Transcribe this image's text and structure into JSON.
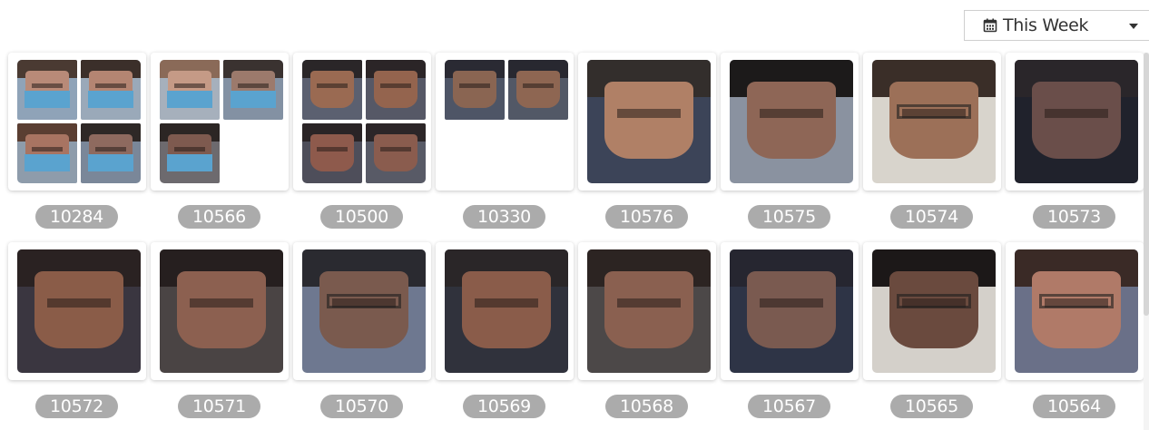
{
  "filter": {
    "range_label": "This Week",
    "icon": "calendar-icon"
  },
  "items": [
    {
      "id": "10284",
      "kind": "group",
      "faces": [
        {
          "bg": "#8fa3b8",
          "hair": "#4a3a32",
          "skin": "#b88a78",
          "mask": true
        },
        {
          "bg": "#9aa9b9",
          "hair": "#3b2f2a",
          "skin": "#b48572",
          "mask": true
        },
        {
          "bg": "#8e9cab",
          "hair": "#5a3e32",
          "skin": "#a87462",
          "mask": true
        },
        {
          "bg": "#7a8799",
          "hair": "#2e2826",
          "skin": "#8e6a5f",
          "mask": true
        }
      ]
    },
    {
      "id": "10566",
      "kind": "group",
      "faces": [
        {
          "bg": "#a6b0bc",
          "hair": "#8a6a58",
          "skin": "#c59a86",
          "mask": true
        },
        {
          "bg": "#8391a3",
          "hair": "#3a3230",
          "skin": "#9c7a6c",
          "mask": true
        },
        {
          "bg": "#6d6a6e",
          "hair": "#2c2624",
          "skin": "#7e5a4f",
          "mask": true
        }
      ]
    },
    {
      "id": "10500",
      "kind": "group",
      "faces": [
        {
          "bg": "#5b6070",
          "hair": "#2a2628",
          "skin": "#9a6a52"
        },
        {
          "bg": "#565866",
          "hair": "#2b2527",
          "skin": "#94644e"
        },
        {
          "bg": "#4e4e5a",
          "hair": "#2a2426",
          "skin": "#8e5a4c"
        },
        {
          "bg": "#585a66",
          "hair": "#2c2628",
          "skin": "#8a5c4e"
        }
      ]
    },
    {
      "id": "10330",
      "kind": "group",
      "faces": [
        {
          "bg": "#4e5566",
          "hair": "#2a2a33",
          "skin": "#8a6552"
        },
        {
          "bg": "#525866",
          "hair": "#282830",
          "skin": "#8e6652"
        }
      ]
    },
    {
      "id": "10576",
      "kind": "single",
      "face": {
        "bg": "#3c4458",
        "hair": "#332e2c",
        "skin": "#b08066"
      }
    },
    {
      "id": "10575",
      "kind": "single",
      "face": {
        "bg": "#8a92a0",
        "hair": "#1c1a1a",
        "skin": "#8e6656"
      }
    },
    {
      "id": "10574",
      "kind": "single",
      "face": {
        "bg": "#d8d4cc",
        "hair": "#3a2e28",
        "skin": "#9c7058",
        "glasses": true
      }
    },
    {
      "id": "10573",
      "kind": "single",
      "face": {
        "bg": "#20222c",
        "hair": "#2a262a",
        "skin": "#6a4e4a"
      }
    },
    {
      "id": "10572",
      "kind": "single",
      "face": {
        "bg": "#3a3640",
        "hair": "#2a2222",
        "skin": "#8a5c48"
      }
    },
    {
      "id": "10571",
      "kind": "single",
      "face": {
        "bg": "#4a4444",
        "hair": "#261f1f",
        "skin": "#8c6050"
      }
    },
    {
      "id": "10570",
      "kind": "single",
      "face": {
        "bg": "#6e7890",
        "hair": "#2a2a30",
        "skin": "#7a5a4e",
        "glasses": true
      }
    },
    {
      "id": "10569",
      "kind": "single",
      "face": {
        "bg": "#30323c",
        "hair": "#2a2628",
        "skin": "#8a5c4a"
      }
    },
    {
      "id": "10568",
      "kind": "single",
      "face": {
        "bg": "#4c4848",
        "hair": "#2c2422",
        "skin": "#8a6050"
      }
    },
    {
      "id": "10567",
      "kind": "single",
      "face": {
        "bg": "#2e3446",
        "hair": "#262630",
        "skin": "#7a5a50"
      }
    },
    {
      "id": "10565",
      "kind": "single",
      "face": {
        "bg": "#d4d0ca",
        "hair": "#1c1818",
        "skin": "#6a4a3e",
        "glasses": true
      }
    },
    {
      "id": "10564",
      "kind": "single",
      "face": {
        "bg": "#6a7088",
        "hair": "#3a2a26",
        "skin": "#b07a68",
        "glasses": true
      }
    }
  ]
}
